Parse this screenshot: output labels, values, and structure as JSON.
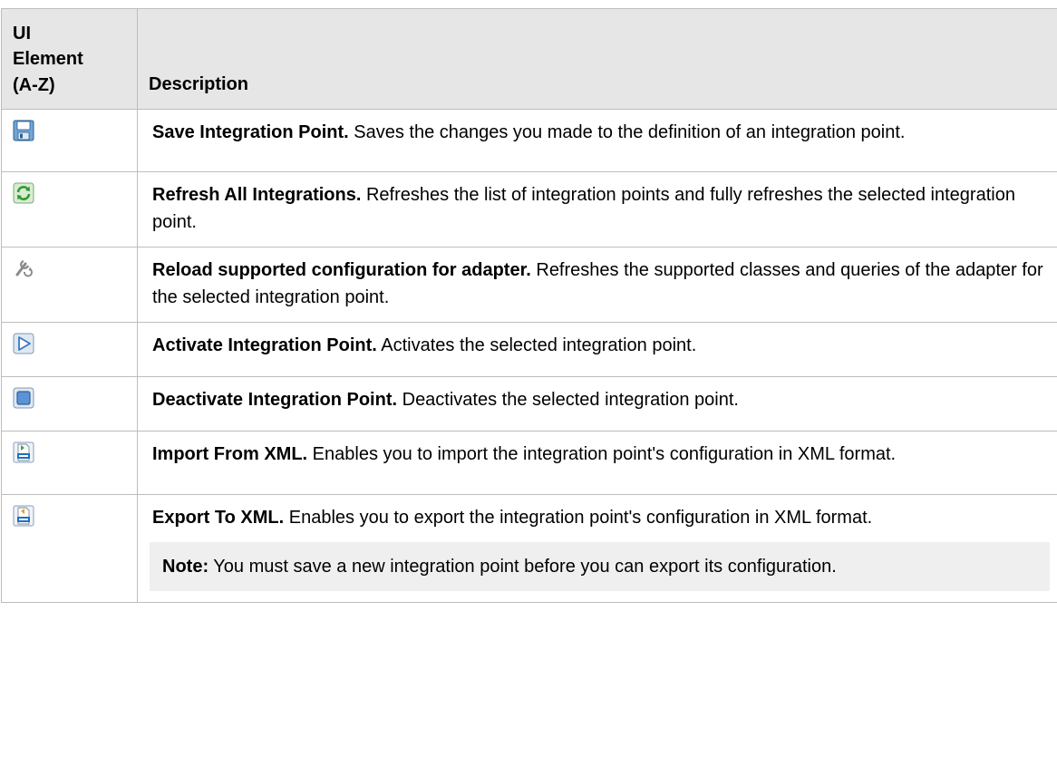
{
  "table": {
    "headers": {
      "col1": "UI Element (A-Z)",
      "col1_lines": [
        "UI",
        "Element",
        "(A-Z)"
      ],
      "col2": "Description"
    },
    "rows": [
      {
        "icon": "save-icon",
        "term": "Save Integration Point.",
        "text": " Saves the changes you made to the definition of an integration point."
      },
      {
        "icon": "refresh-icon",
        "term": "Refresh All Integrations.",
        "text": " Refreshes the list of integration points and fully refreshes the selected integration point."
      },
      {
        "icon": "reload-adapter-config-icon",
        "term": "Reload supported configuration for adapter.",
        "text": " Refreshes the supported classes and queries of the adapter for the selected integration point."
      },
      {
        "icon": "activate-play-icon",
        "term": "Activate Integration Point.",
        "text": " Activates the selected integration point."
      },
      {
        "icon": "deactivate-stop-icon",
        "term": "Deactivate Integration Point.",
        "text": " Deactivates the selected integration point."
      },
      {
        "icon": "import-xml-icon",
        "term": "Import From XML.",
        "text": " Enables you to import the integration point's configuration in XML format."
      },
      {
        "icon": "export-xml-icon",
        "term": "Export To XML.",
        "text": " Enables you to export the integration point's configuration in XML format.",
        "note": {
          "label": "Note:",
          "text": " You must save a new integration point before you can export its configuration."
        }
      }
    ]
  },
  "colors": {
    "header_bg": "#e6e6e6",
    "border": "#bdbdbd",
    "note_bg": "#efefef"
  }
}
